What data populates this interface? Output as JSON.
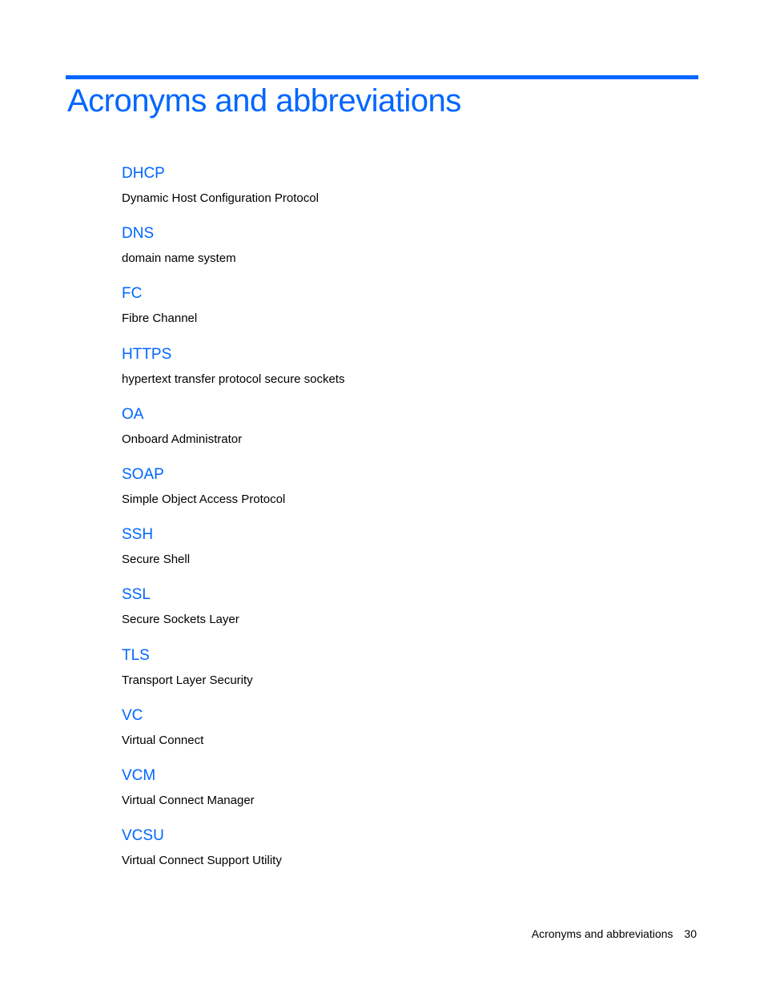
{
  "page": {
    "title": "Acronyms and abbreviations",
    "accent_color": "#0066ff"
  },
  "entries": [
    {
      "term": "DHCP",
      "definition": "Dynamic Host Configuration Protocol"
    },
    {
      "term": "DNS",
      "definition": "domain name system"
    },
    {
      "term": "FC",
      "definition": "Fibre Channel"
    },
    {
      "term": "HTTPS",
      "definition": "hypertext transfer protocol secure sockets"
    },
    {
      "term": "OA",
      "definition": "Onboard Administrator"
    },
    {
      "term": "SOAP",
      "definition": "Simple Object Access Protocol"
    },
    {
      "term": "SSH",
      "definition": "Secure Shell"
    },
    {
      "term": "SSL",
      "definition": "Secure Sockets Layer"
    },
    {
      "term": "TLS",
      "definition": "Transport Layer Security"
    },
    {
      "term": "VC",
      "definition": "Virtual Connect"
    },
    {
      "term": "VCM",
      "definition": "Virtual Connect Manager"
    },
    {
      "term": "VCSU",
      "definition": "Virtual Connect Support Utility"
    }
  ],
  "footer": {
    "section": "Acronyms and abbreviations",
    "page_number": "30"
  }
}
